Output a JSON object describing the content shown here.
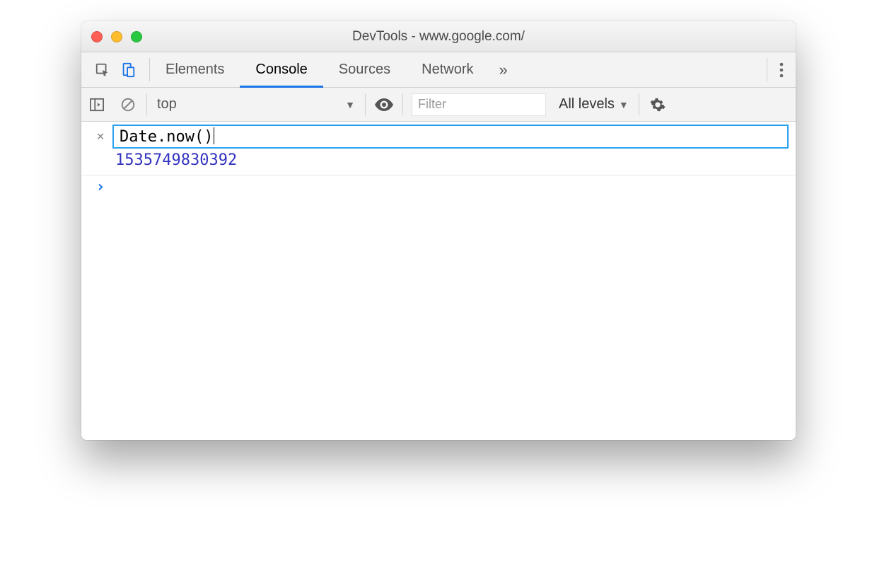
{
  "window": {
    "title": "DevTools - www.google.com/"
  },
  "tabs": {
    "elements": "Elements",
    "console": "Console",
    "sources": "Sources",
    "network": "Network"
  },
  "subbar": {
    "context": "top",
    "filter_placeholder": "Filter",
    "levels": "All levels"
  },
  "console": {
    "expression": "Date.now()",
    "result": "1535749830392"
  }
}
